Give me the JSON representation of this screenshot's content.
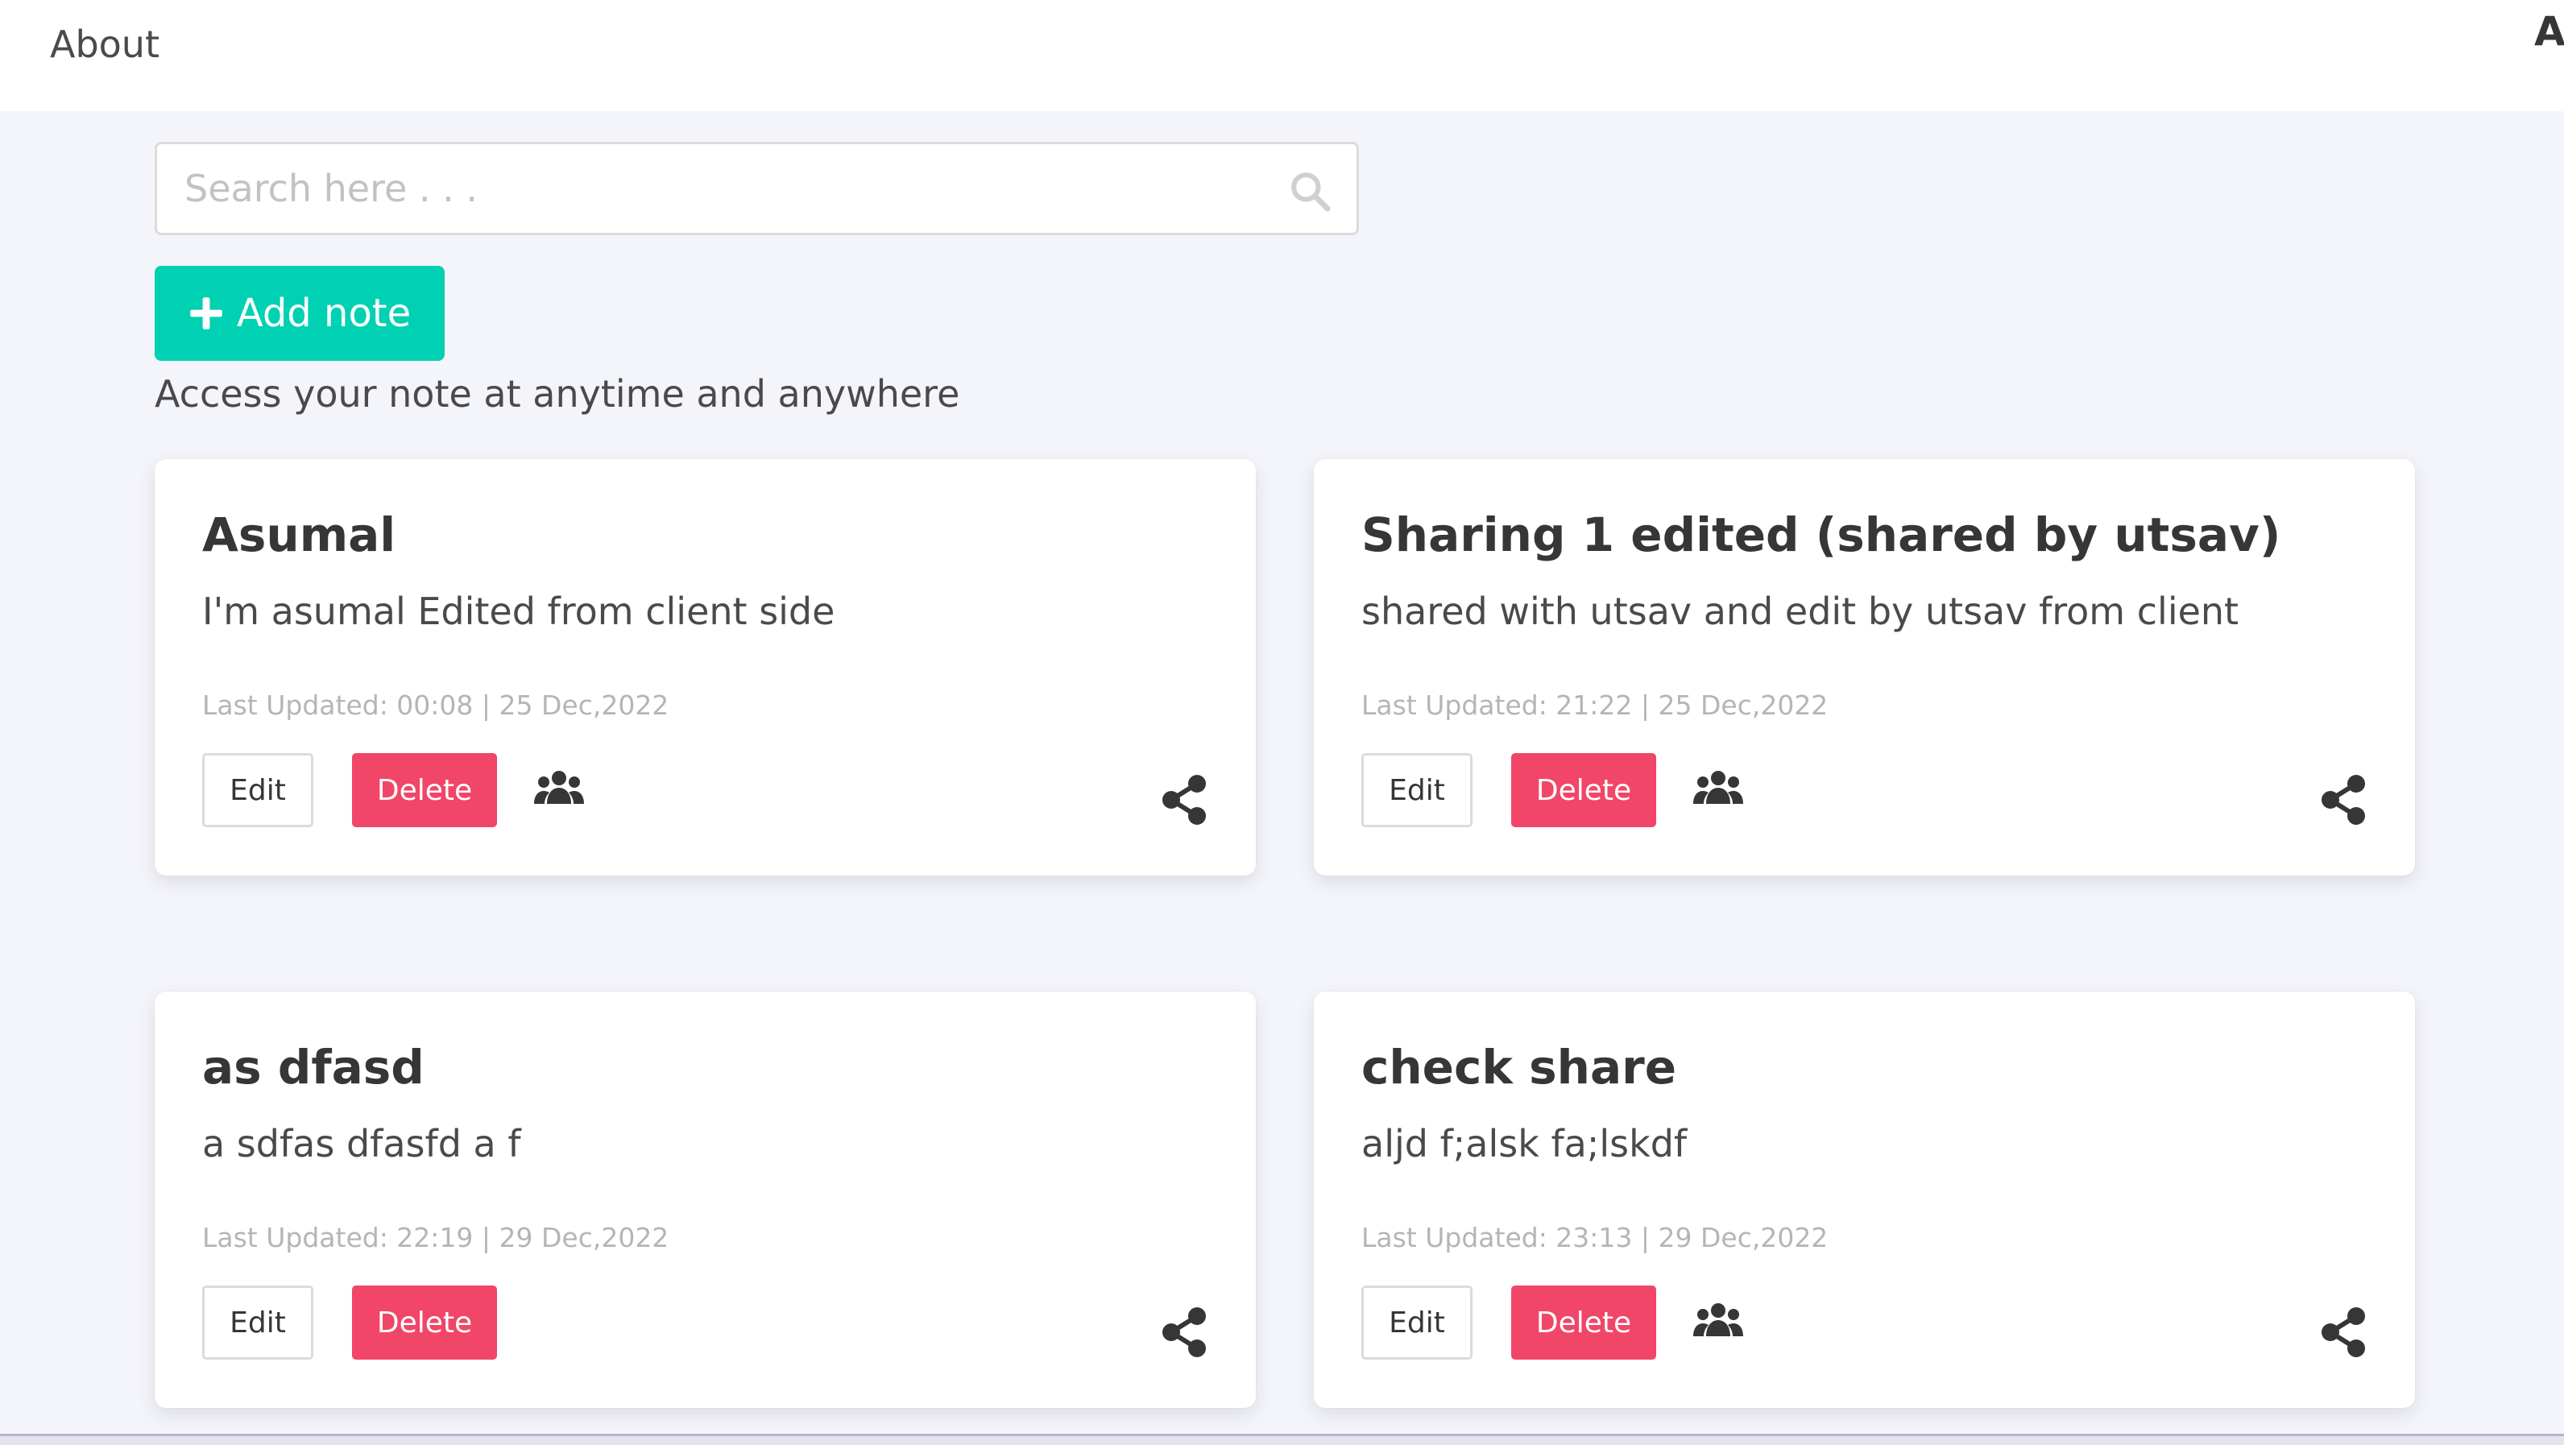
{
  "nav": {
    "about_label": "About",
    "right_label": "A"
  },
  "search": {
    "placeholder": "Search here . . .",
    "value": "",
    "icon": "search-icon"
  },
  "add_note": {
    "label": "Add note",
    "icon": "plus-icon",
    "color": "#00d1b2"
  },
  "subtitle": "Access your note at anytime and anywhere",
  "colors": {
    "page_background": "#f4f5fb",
    "delete_button": "#f14668",
    "muted_text": "#b5b5b5"
  },
  "notes": [
    {
      "title": "Asumal",
      "body": "I'm asumal Edited from client side",
      "updated": "Last Updated: 00:08 | 25 Dec,2022",
      "edit_label": "Edit",
      "delete_label": "Delete",
      "shared_icon": true,
      "share_icon": "share-icon"
    },
    {
      "title": "Sharing 1 edited (shared by utsav)",
      "body": "shared with utsav and edit by utsav from client",
      "updated": "Last Updated: 21:22 | 25 Dec,2022",
      "edit_label": "Edit",
      "delete_label": "Delete",
      "shared_icon": true,
      "share_icon": "share-icon"
    },
    {
      "title": "as dfasd",
      "body": "a sdfas dfasfd a f",
      "updated": "Last Updated: 22:19 | 29 Dec,2022",
      "edit_label": "Edit",
      "delete_label": "Delete",
      "shared_icon": false,
      "share_icon": "share-icon"
    },
    {
      "title": "check share",
      "body": "aljd f;alsk fa;lskdf",
      "updated": "Last Updated: 23:13 | 29 Dec,2022",
      "edit_label": "Edit",
      "delete_label": "Delete",
      "shared_icon": true,
      "share_icon": "share-icon"
    }
  ]
}
